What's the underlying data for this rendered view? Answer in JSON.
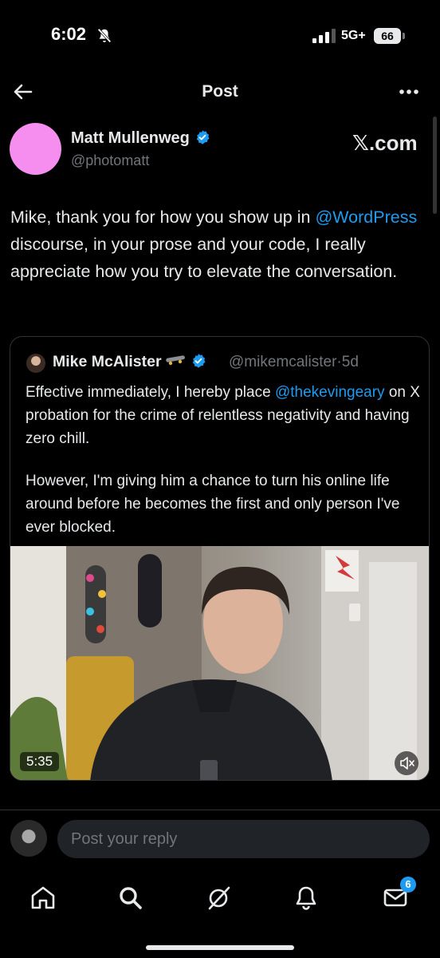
{
  "status_bar": {
    "time": "6:02",
    "network": "5G+",
    "battery": "66",
    "icons": [
      "bell-off-icon",
      "signal-icon",
      "battery-icon"
    ]
  },
  "header": {
    "title": "Post",
    "back_icon": "arrow-left-icon",
    "more_icon": "more-horizontal-icon"
  },
  "post": {
    "author_name": "Matt Mullenweg",
    "author_handle": "@photomatt",
    "brand": "𝕏.com",
    "text_before": "Mike, thank you for how you show up in ",
    "mention": "@WordPress",
    "text_after": " discourse, in your prose and your code, I really appreciate how you try to elevate the conversation."
  },
  "quote": {
    "name": "Mike McAlister",
    "handle": "@mikemcalister",
    "separator": "·",
    "age": "5d",
    "para1_before": "Effective immediately, I hereby place ",
    "para1_mention": "@thekevingeary",
    "para1_after": " on X probation for the crime of relentless negativity and having zero chill.",
    "para2": "However, I'm giving him a chance to turn his online life around before he becomes the first and only person I've ever blocked.",
    "video": {
      "duration": "5:35",
      "mute_icon": "speaker-muted-icon"
    }
  },
  "reply": {
    "placeholder": "Post your reply"
  },
  "tabs": [
    {
      "name": "home",
      "icon": "home-icon"
    },
    {
      "name": "search",
      "icon": "search-icon"
    },
    {
      "name": "grok",
      "icon": "grok-icon"
    },
    {
      "name": "notifications",
      "icon": "bell-icon"
    },
    {
      "name": "messages",
      "icon": "mail-icon",
      "badge": "6"
    }
  ],
  "colors": {
    "background": "#000000",
    "text": "#e7e9ea",
    "muted": "#71767b",
    "accent": "#1d9bf0",
    "avatar_pink": "#f68ef0"
  }
}
